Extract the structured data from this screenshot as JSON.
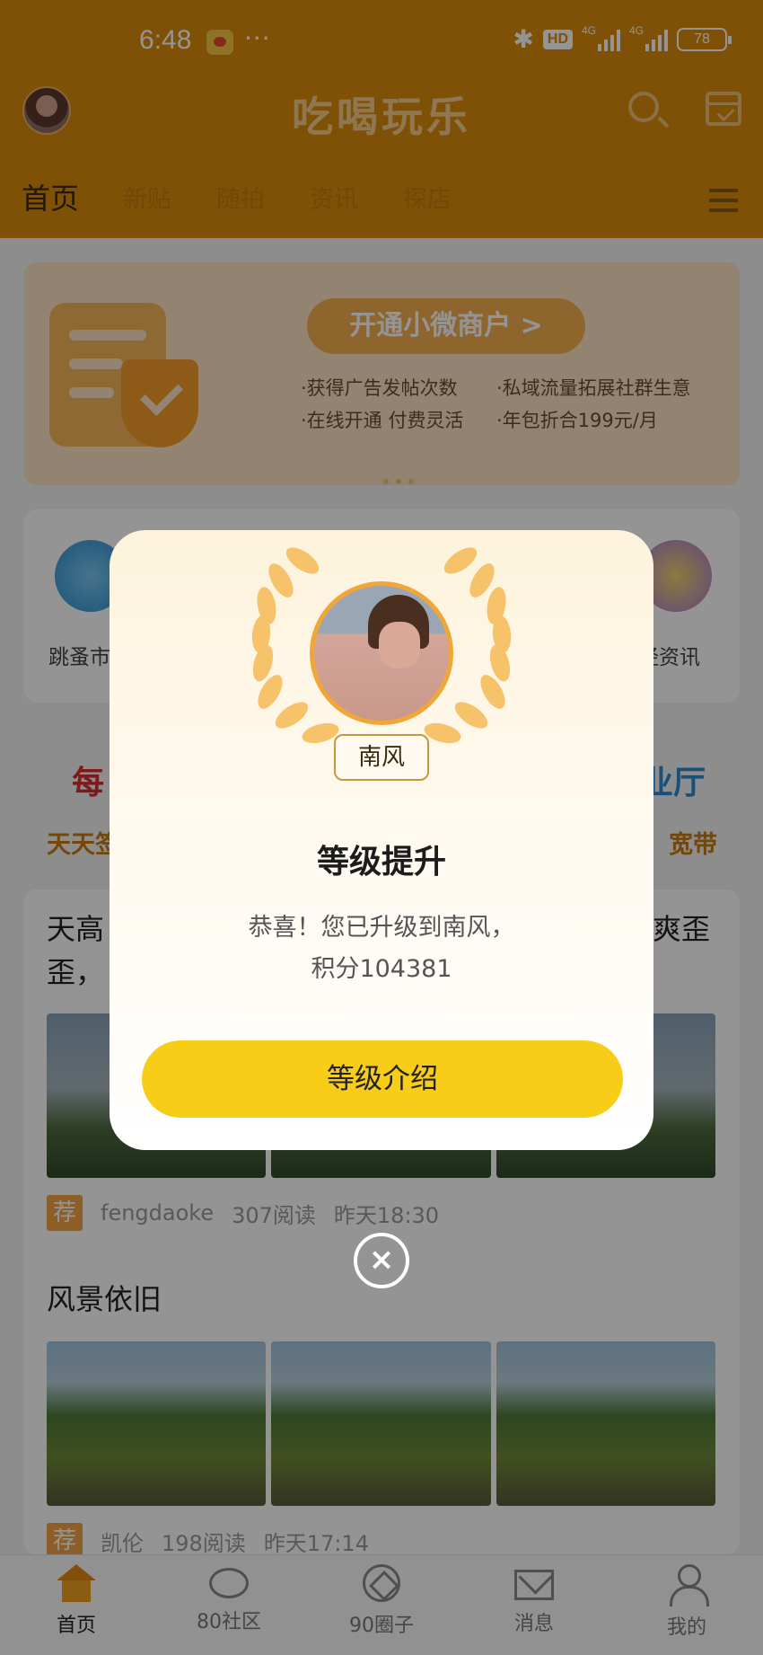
{
  "status_bar": {
    "time": "6:48",
    "dots": "···",
    "hd": "HD",
    "net1": "4G",
    "net2": "4G",
    "battery": "78"
  },
  "app_bar": {
    "title": "吃喝玩乐"
  },
  "nav": {
    "tabs": [
      "首页",
      "新贴",
      "随拍",
      "资讯",
      "探店"
    ]
  },
  "banner": {
    "button": "开通小微商户 >",
    "lines": [
      "·获得广告发帖次数",
      "·私域流量拓展社群生意",
      "·在线开通 付费灵活",
      "·年包折合199元/月"
    ]
  },
  "quick": {
    "left_label": "跳蚤市",
    "right_label": "经资讯"
  },
  "promo": {
    "left": "每",
    "left_sub": "天天签",
    "right": "业厅",
    "right_sub": "宽带"
  },
  "feed": {
    "post1": {
      "title_line1": "天高",
      "title_line1_right": "爽歪",
      "title_line2": "歪，",
      "author": "fengdaoke",
      "reads": "307阅读",
      "time": "昨天18:30",
      "tag": "荐"
    },
    "post2": {
      "title": "风景依旧",
      "author": "凯伦",
      "reads": "198阅读",
      "time": "昨天17:14",
      "tag": "荐"
    }
  },
  "bottom_nav": [
    "首页",
    "80社区",
    "90圈子",
    "消息",
    "我的"
  ],
  "modal": {
    "level_badge": "南风",
    "title": "等级提升",
    "message_line1": "恭喜！您已升级到南风，",
    "message_line2": "积分104381",
    "button": "等级介绍",
    "close": "×"
  },
  "colors": {
    "brand": "#d98c0c",
    "button_yellow": "#f8cd18",
    "promo_red": "#d73030",
    "promo_blue": "#2a8ad6"
  }
}
